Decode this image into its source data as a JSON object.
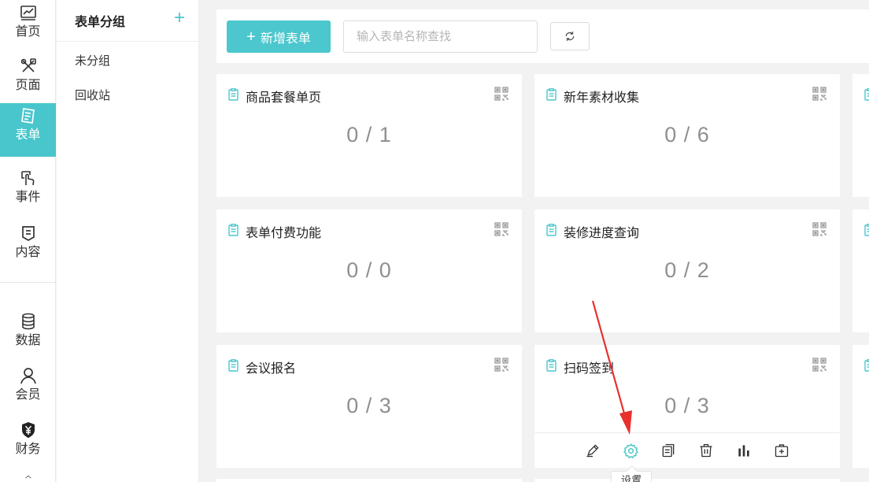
{
  "nav": {
    "items": [
      {
        "label": "首页",
        "icon": "chart-line-icon"
      },
      {
        "label": "页面",
        "icon": "tools-icon"
      },
      {
        "label": "表单",
        "icon": "form-icon"
      },
      {
        "label": "事件",
        "icon": "touch-icon"
      },
      {
        "label": "内容",
        "icon": "content-icon"
      },
      {
        "label": "数据",
        "icon": "database-icon"
      },
      {
        "label": "会员",
        "icon": "user-icon"
      },
      {
        "label": "财务",
        "icon": "yuan-shield-icon"
      }
    ],
    "active_index": 2,
    "active_color": "#48c6cc"
  },
  "groups": {
    "title": "表单分组",
    "add_label": "+",
    "items": [
      "未分组",
      "回收站"
    ]
  },
  "toolbar": {
    "new_label": "新增表单",
    "new_plus": "+",
    "search_placeholder": "输入表单名称查找"
  },
  "forms": [
    {
      "title": "商品套餐单页",
      "count": "0 / 1"
    },
    {
      "title": "新年素材收集",
      "count": "0 / 6"
    },
    {
      "title": "表单付费功能",
      "count": "0 / 0"
    },
    {
      "title": "装修进度查询",
      "count": "0 / 2"
    },
    {
      "title": "会议报名",
      "count": "0 / 3"
    },
    {
      "title": "扫码签到",
      "count": "0 / 3"
    }
  ],
  "card_actions": [
    "edit-icon",
    "settings-icon",
    "copy-icon",
    "delete-icon",
    "stats-icon",
    "medical-box-icon"
  ],
  "tooltip": {
    "text": "设置"
  },
  "colors": {
    "accent": "#4bc7cd",
    "arrow": "#e8302c"
  }
}
